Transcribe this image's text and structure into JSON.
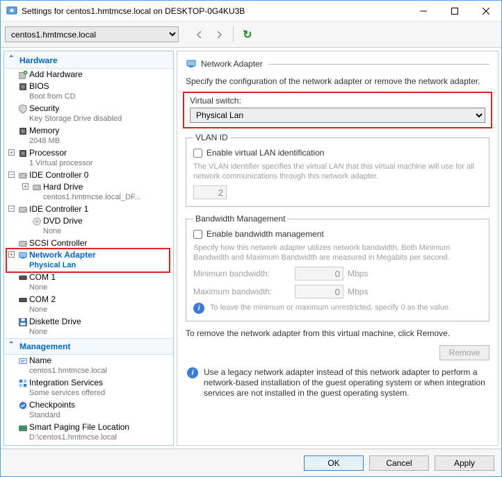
{
  "window": {
    "title": "Settings for centos1.hmtmcse.local on DESKTOP-0G4KU3B"
  },
  "toolbar": {
    "vm_selector": "centos1.hmtmcse.local"
  },
  "sidebar": {
    "sections": [
      {
        "label": "Hardware",
        "items": [
          {
            "label": "Add Hardware",
            "sub": ""
          },
          {
            "label": "BIOS",
            "sub": "Boot from CD"
          },
          {
            "label": "Security",
            "sub": "Key Storage Drive disabled"
          },
          {
            "label": "Memory",
            "sub": "2048 MB"
          },
          {
            "label": "Processor",
            "sub": "1 Virtual processor",
            "expander": "+"
          },
          {
            "label": "IDE Controller 0",
            "sub": "",
            "expander": "−",
            "children": [
              {
                "label": "Hard Drive",
                "sub": "centos1.hmtmcse.local_DF...",
                "expander": "+"
              }
            ]
          },
          {
            "label": "IDE Controller 1",
            "sub": "",
            "expander": "−",
            "children": [
              {
                "label": "DVD Drive",
                "sub": "None"
              }
            ]
          },
          {
            "label": "SCSI Controller",
            "sub": ""
          },
          {
            "label": "Network Adapter",
            "sub": "Physical Lan",
            "expander": "+",
            "selected": true
          },
          {
            "label": "COM 1",
            "sub": "None"
          },
          {
            "label": "COM 2",
            "sub": "None"
          },
          {
            "label": "Diskette Drive",
            "sub": "None"
          }
        ]
      },
      {
        "label": "Management",
        "items": [
          {
            "label": "Name",
            "sub": "centos1.hmtmcse.local"
          },
          {
            "label": "Integration Services",
            "sub": "Some services offered"
          },
          {
            "label": "Checkpoints",
            "sub": "Standard"
          },
          {
            "label": "Smart Paging File Location",
            "sub": "D:\\centos1.hmtmcse.local"
          }
        ]
      }
    ]
  },
  "content": {
    "heading": "Network Adapter",
    "intro": "Specify the configuration of the network adapter or remove the network adapter.",
    "vswitch_label": "Virtual switch:",
    "vswitch_value": "Physical Lan",
    "vlan": {
      "legend": "VLAN ID",
      "cb": "Enable virtual LAN identification",
      "hint": "The VLAN identifier specifies the virtual LAN that this virtual machine will use for all network communications through this network adapter.",
      "value": "2"
    },
    "bw": {
      "legend": "Bandwidth Management",
      "cb": "Enable bandwidth management",
      "hint": "Specify how this network adapter utilizes network bandwidth. Both Minimum Bandwidth and Maximum Bandwidth are measured in Megabits per second.",
      "min_label": "Minimum bandwidth:",
      "min_value": "0",
      "max_label": "Maximum bandwidth:",
      "max_value": "0",
      "unit": "Mbps",
      "info": "To leave the minimum or maximum unrestricted, specify 0 as the value."
    },
    "remove_text": "To remove the network adapter from this virtual machine, click Remove.",
    "remove_btn": "Remove",
    "legacy": "Use a legacy network adapter instead of this network adapter to perform a network-based installation of the guest operating system or when integration services are not installed in the guest operating system."
  },
  "footer": {
    "ok": "OK",
    "cancel": "Cancel",
    "apply": "Apply"
  }
}
